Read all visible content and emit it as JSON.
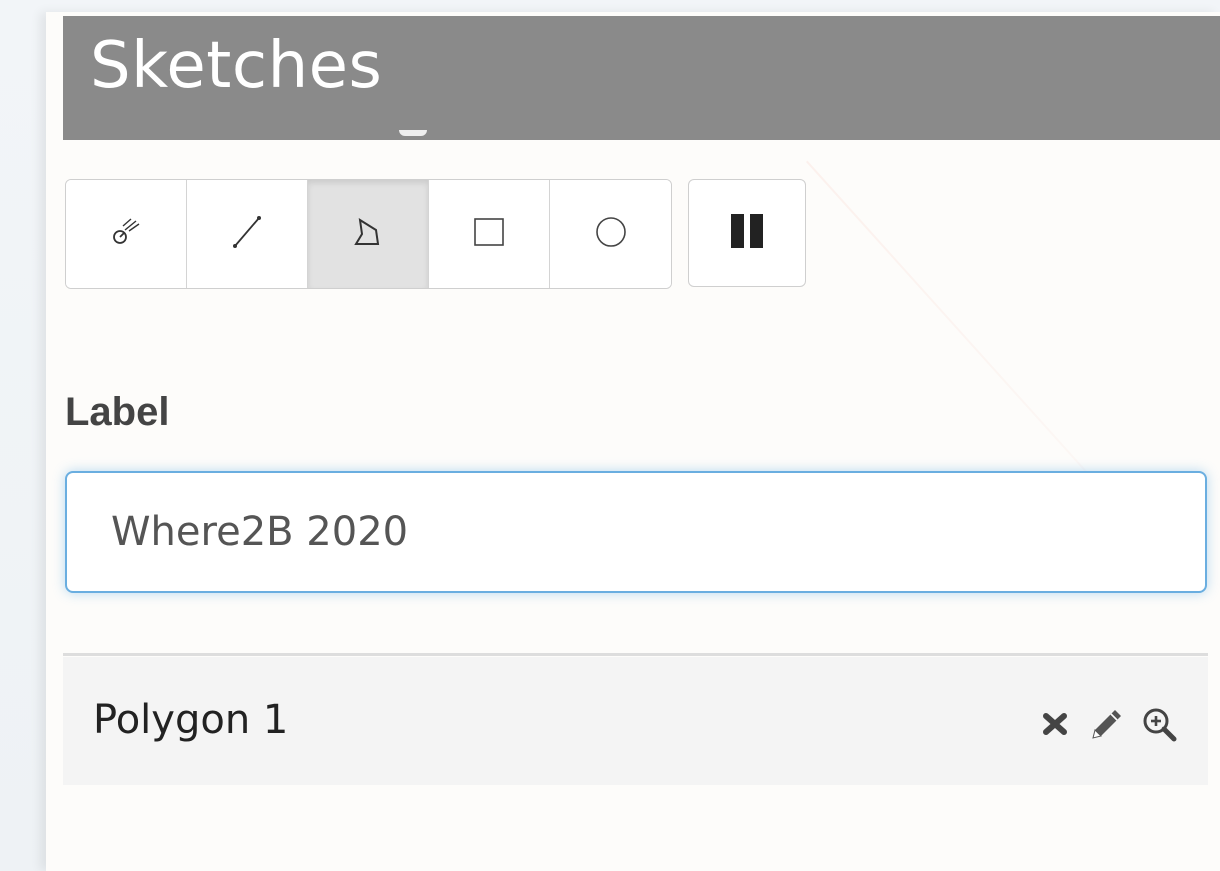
{
  "panel": {
    "title": "Sketches"
  },
  "toolbar": {
    "tools": [
      {
        "icon": "point-marker-icon",
        "active": false
      },
      {
        "icon": "line-icon",
        "active": false
      },
      {
        "icon": "polygon-icon",
        "active": true
      },
      {
        "icon": "rectangle-icon",
        "active": false
      },
      {
        "icon": "circle-icon",
        "active": false
      }
    ],
    "pause_icon": "pause-icon"
  },
  "label_section": {
    "heading": "Label",
    "input_value": "Where2B 2020"
  },
  "sketches": [
    {
      "name": "Polygon 1",
      "actions": [
        "delete-icon",
        "edit-pencil-icon",
        "zoom-in-icon"
      ]
    }
  ],
  "colors": {
    "header_bg": "#8a8a8a",
    "input_focus": "#6aaee0",
    "row_bg": "#f4f4f4"
  }
}
